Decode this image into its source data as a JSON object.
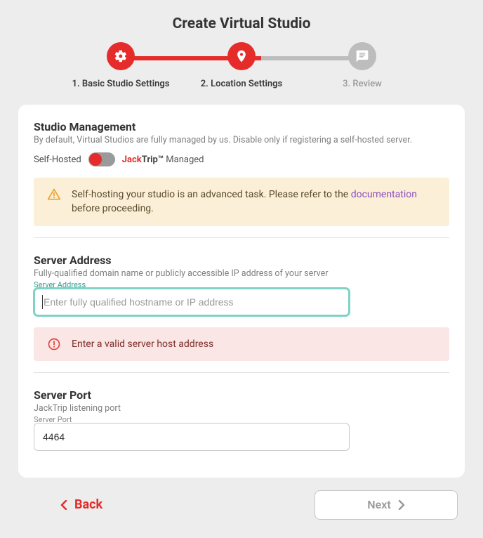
{
  "page_title": "Create Virtual Studio",
  "steps": [
    {
      "label": "1. Basic Studio Settings",
      "state": "active",
      "icon": "gear"
    },
    {
      "label": "2. Location Settings",
      "state": "active",
      "icon": "pin"
    },
    {
      "label": "3. Review",
      "state": "inactive",
      "icon": "chat"
    }
  ],
  "management": {
    "heading": "Studio Management",
    "sub": "By default, Virtual Studios are fully managed by us. Disable only if registering a self-hosted server.",
    "left_label": "Self-Hosted",
    "brand_jack": "Jack",
    "brand_trip": "Trip™",
    "managed": " Managed",
    "warn_pre": "Self-hosting your studio is an advanced task. Please refer to the ",
    "warn_link": "documentation",
    "warn_post": " before proceeding."
  },
  "address": {
    "heading": "Server Address",
    "sub": "Fully-qualified domain name or publicly accessible IP address of your server",
    "float": "Server Address",
    "placeholder": "Enter fully qualified hostname or IP address",
    "value": "",
    "error": "Enter a valid server host address"
  },
  "port": {
    "heading": "Server Port",
    "sub": "JackTrip listening port",
    "float": "Server Port",
    "value": "4464"
  },
  "footer": {
    "back": "Back",
    "next": "Next"
  }
}
